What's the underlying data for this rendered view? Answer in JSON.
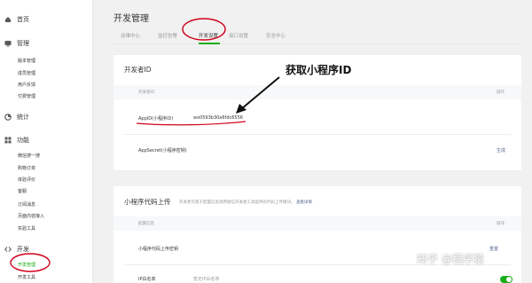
{
  "sidebar": {
    "home": "首页",
    "manage": "管理",
    "manage_items": [
      "版本管理",
      "成员管理",
      "用户反馈",
      "付费管理"
    ],
    "stats": "统计",
    "features": "功能",
    "feature_items": [
      "微信搜一搜",
      "购物订单",
      "体验评价",
      "客服",
      "订阅消息",
      "页面内容接入",
      "实验工具"
    ],
    "dev": "开发",
    "dev_items": [
      "开发管理",
      "开发工具"
    ]
  },
  "page": {
    "title": "开发管理",
    "tabs": [
      "运维中心",
      "监控告警",
      "开发设置",
      "接口设置",
      "安全中心"
    ]
  },
  "developer_id": {
    "heading": "开发者ID",
    "col_id": "开发者ID",
    "col_action": "操作",
    "appid_label": "AppID(小程序ID)",
    "appid_value": "wx0593b30a6fdc6556",
    "appsecret_label": "AppSecret(小程序密钥)",
    "generate": "生成"
  },
  "upload": {
    "heading": "小程序代码上传",
    "note": "开发者可基于配置信息调用微信开发者工具提供的代码上传模块。",
    "note_link": "查看详情",
    "col_config": "配置信息",
    "col_action": "操作",
    "key_label": "小程序代码上传密钥",
    "reset": "重置",
    "ip_label": "IP白名单",
    "ip_value": "暂无IP白名单"
  },
  "annotation": "获取小程序ID",
  "watermark": "知乎 @程序猿",
  "colors": {
    "accent": "#1aad19",
    "link": "#576b95",
    "annotation_red": "#d0021b"
  }
}
